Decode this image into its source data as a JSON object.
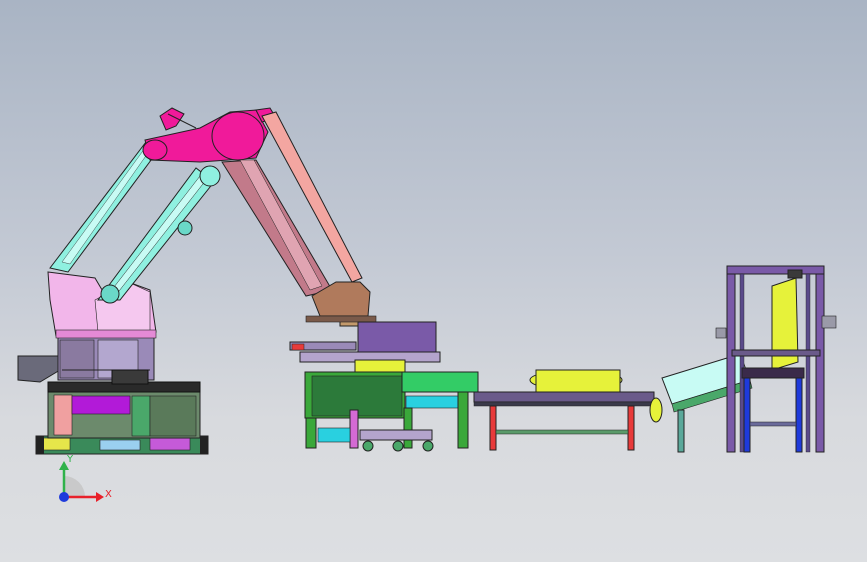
{
  "viewport": {
    "view": "front",
    "background_gradient": [
      "#a9b4c4",
      "#dddfe2"
    ]
  },
  "colors": {
    "robot_arm_pink": "#f01a9a",
    "robot_base_pink": "#f2b6ea",
    "robot_link_cyan": "#8ff0e0",
    "robot_link_salmon": "#f3a6a1",
    "gripper_brown": "#b07a5c",
    "bag_yellow": "#e6f23a",
    "conveyor_green": "#33cc66",
    "frame_purple": "#7a5aa8"
  },
  "triad": {
    "x_label": "X",
    "y_label": "Y",
    "x_color": "#e8202a",
    "y_color": "#2fb24a",
    "z_color": "#1e3adb"
  },
  "machines": [
    {
      "name": "palletizing-robot"
    },
    {
      "name": "gripper-station"
    },
    {
      "name": "belt-conveyor"
    },
    {
      "name": "inclined-conveyor"
    },
    {
      "name": "bag-flattening-frame"
    }
  ]
}
